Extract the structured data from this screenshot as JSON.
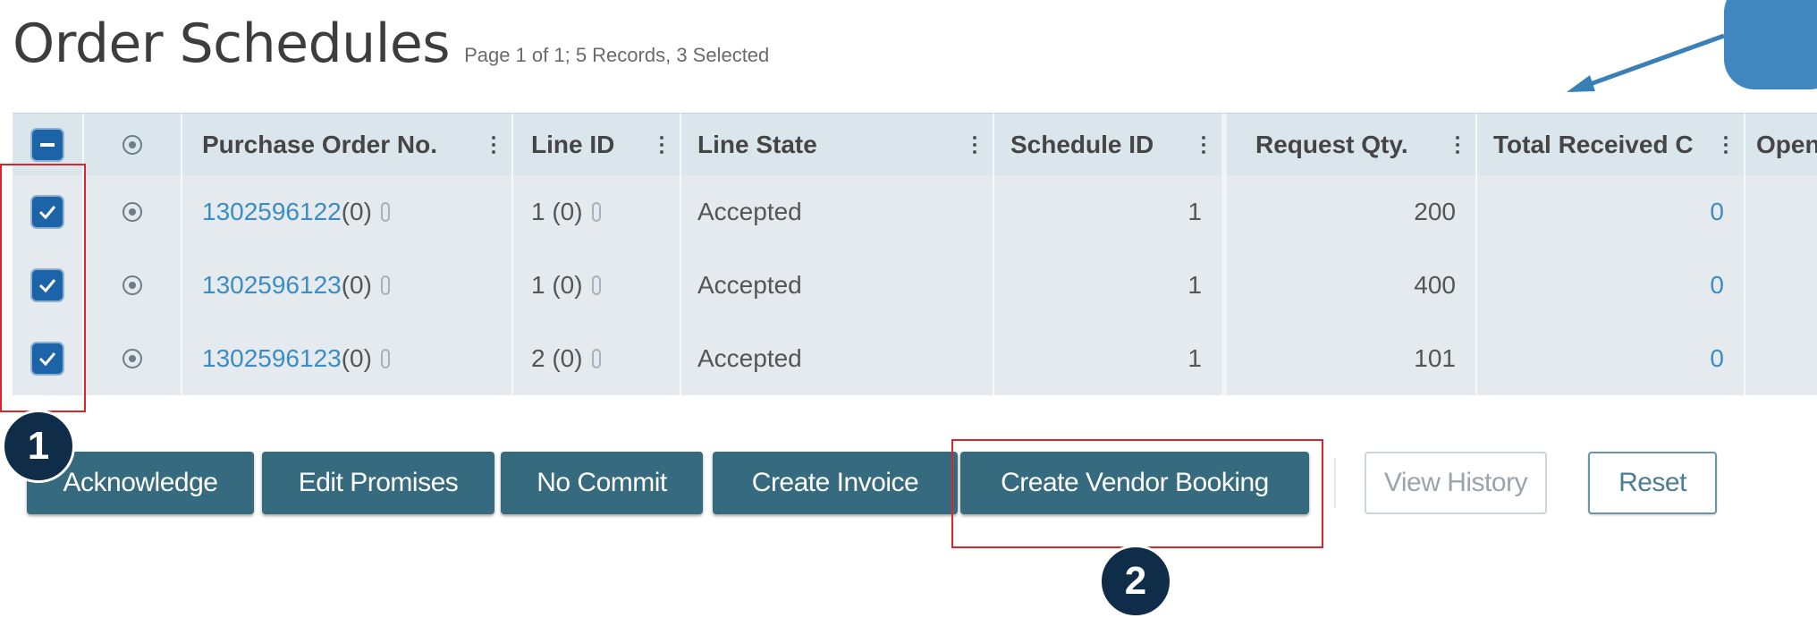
{
  "header": {
    "title": "Order Schedules",
    "subtitle": "Page 1 of 1; 5 Records, 3 Selected"
  },
  "grid": {
    "columns": [
      {
        "key": "select",
        "label": ""
      },
      {
        "key": "expand",
        "label": ""
      },
      {
        "key": "po",
        "label": "Purchase Order No."
      },
      {
        "key": "line_id",
        "label": "Line ID"
      },
      {
        "key": "line_state",
        "label": "Line State"
      },
      {
        "key": "schedule_id",
        "label": "Schedule ID"
      },
      {
        "key": "request_qty",
        "label": "Request Qty."
      },
      {
        "key": "total_received",
        "label": "Total Received C"
      },
      {
        "key": "open",
        "label": "Open"
      }
    ],
    "rows": [
      {
        "selected": true,
        "po_number": "1302596122",
        "po_suffix": " (0)",
        "line_id": "1 (0)",
        "line_state": "Accepted",
        "schedule_id": "1",
        "request_qty": "200",
        "total_received": "0"
      },
      {
        "selected": true,
        "po_number": "1302596123",
        "po_suffix": " (0)",
        "line_id": "1 (0)",
        "line_state": "Accepted",
        "schedule_id": "1",
        "request_qty": "400",
        "total_received": "0"
      },
      {
        "selected": true,
        "po_number": "1302596123",
        "po_suffix": " (0)",
        "line_id": "2 (0)",
        "line_state": "Accepted",
        "schedule_id": "1",
        "request_qty": "101",
        "total_received": "0"
      }
    ]
  },
  "actions": {
    "acknowledge": "Acknowledge",
    "edit_promises": "Edit Promises",
    "no_commit": "No Commit",
    "create_invoice": "Create Invoice",
    "create_vendor_booking": "Create Vendor Booking",
    "view_history": "View History",
    "reset": "Reset"
  },
  "annotations": {
    "step1": "1",
    "step2": "2"
  },
  "colors": {
    "button_bg": "#366a7e",
    "checkbox": "#1c63a8",
    "link": "#3b8dc4",
    "highlight": "#d9262c",
    "badge": "#0f2c49",
    "callout": "#3f87be"
  },
  "icons": [
    "expand-icon",
    "attachment-icon",
    "column-menu-icon",
    "checkbox-check-icon"
  ]
}
